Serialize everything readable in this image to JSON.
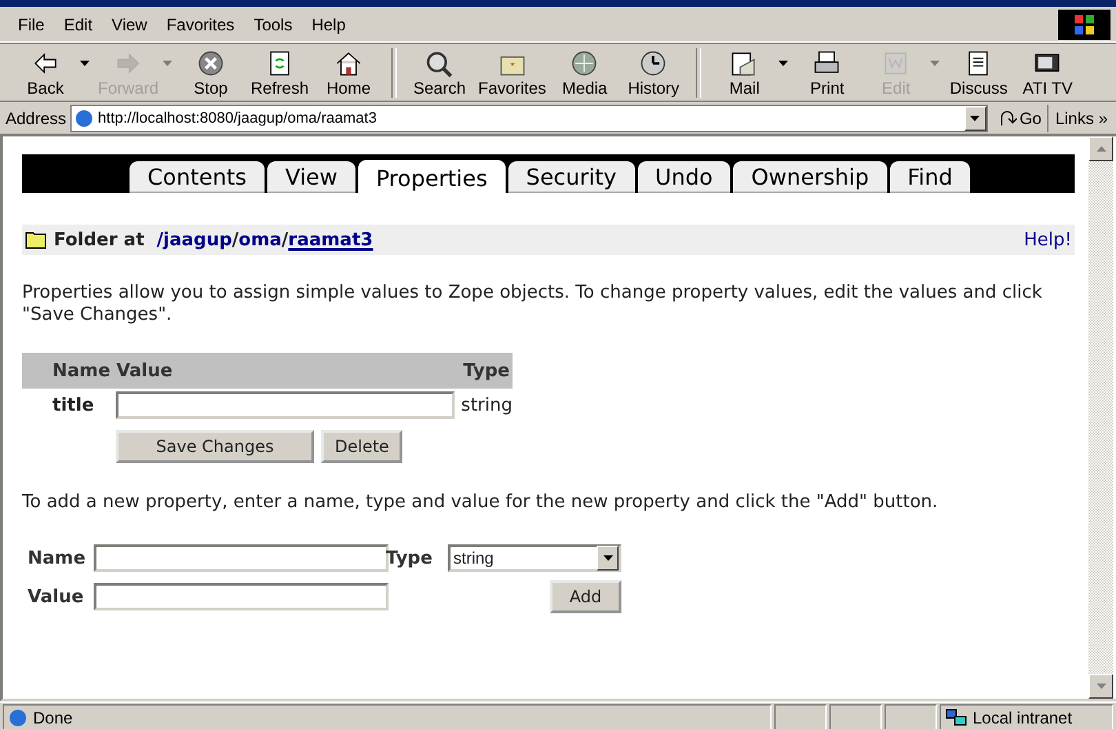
{
  "menu": [
    "File",
    "Edit",
    "View",
    "Favorites",
    "Tools",
    "Help"
  ],
  "toolbar": [
    [
      {
        "label": "Back",
        "disabled": false,
        "dropdown": true
      },
      {
        "label": "Forward",
        "disabled": true,
        "dropdown": true
      },
      {
        "label": "Stop",
        "disabled": false,
        "dropdown": false
      },
      {
        "label": "Refresh",
        "disabled": false,
        "dropdown": false
      },
      {
        "label": "Home",
        "disabled": false,
        "dropdown": false
      }
    ],
    [
      {
        "label": "Search",
        "disabled": false,
        "dropdown": false
      },
      {
        "label": "Favorites",
        "disabled": false,
        "dropdown": false
      },
      {
        "label": "Media",
        "disabled": false,
        "dropdown": false
      },
      {
        "label": "History",
        "disabled": false,
        "dropdown": false
      }
    ],
    [
      {
        "label": "Mail",
        "disabled": false,
        "dropdown": true
      },
      {
        "label": "Print",
        "disabled": false,
        "dropdown": false
      },
      {
        "label": "Edit",
        "disabled": true,
        "dropdown": true
      },
      {
        "label": "Discuss",
        "disabled": false,
        "dropdown": false
      },
      {
        "label": "ATI TV",
        "disabled": false,
        "dropdown": false
      }
    ]
  ],
  "address": {
    "label": "Address",
    "url": "http://localhost:8080/jaagup/oma/raamat3",
    "go": "Go",
    "links": "Links",
    "more": "»"
  },
  "tabs": [
    {
      "label": "Contents",
      "selected": false
    },
    {
      "label": "View",
      "selected": false
    },
    {
      "label": "Properties",
      "selected": true
    },
    {
      "label": "Security",
      "selected": false
    },
    {
      "label": "Undo",
      "selected": false
    },
    {
      "label": "Ownership",
      "selected": false
    },
    {
      "label": "Find",
      "selected": false
    }
  ],
  "location": {
    "label": "Folder at",
    "path": [
      {
        "text": "/jaagup",
        "current": false
      },
      {
        "text": "/",
        "kind": "sep"
      },
      {
        "text": "oma",
        "current": false
      },
      {
        "text": "/",
        "kind": "sep"
      },
      {
        "text": "raamat3",
        "current": true
      }
    ],
    "help": "Help!"
  },
  "intro": "Properties allow you to assign simple values to Zope objects. To change property values, edit the values and click \"Save Changes\".",
  "table": {
    "columns": [
      "Name",
      "Value",
      "Type"
    ],
    "rows": [
      {
        "name": "title",
        "type": "string"
      }
    ]
  },
  "buttons": [
    "Save Changes",
    "Delete"
  ],
  "add_intro": "To add a new property, enter a name, type and value for the new property and click the \"Add\" button.",
  "add_form": {
    "name_label": "Name",
    "type_label": "Type",
    "type_value": "string",
    "value_label": "Value",
    "add": "Add"
  },
  "status_bar": {
    "text": "Done",
    "zone": "Local intranet"
  }
}
